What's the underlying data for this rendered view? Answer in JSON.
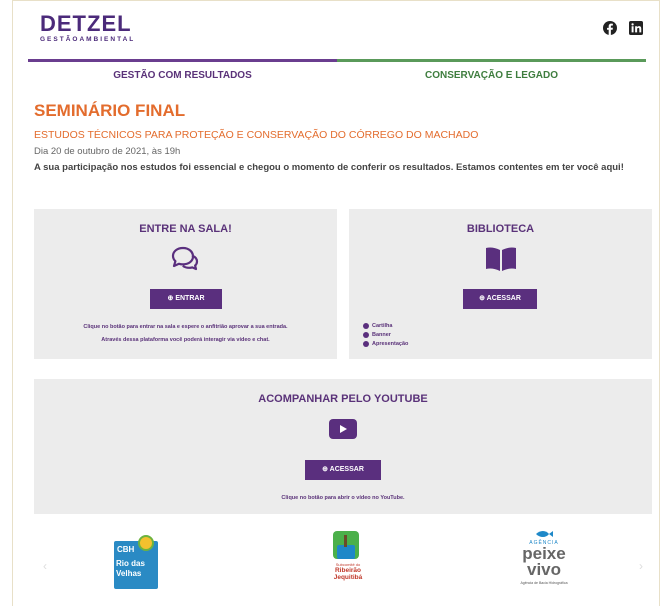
{
  "header": {
    "logo_main": "DETZEL",
    "logo_sub": "GESTÃOAMBIENTAL",
    "social": [
      {
        "name": "facebook-icon"
      },
      {
        "name": "linkedin-icon"
      }
    ]
  },
  "nav": {
    "left_label": "GESTÃO COM RESULTADOS",
    "right_label": "CONSERVAÇÃO E LEGADO",
    "left_color": "#6a3d8f",
    "right_color": "#5a9a5a"
  },
  "event": {
    "title": "SEMINÁRIO FINAL",
    "subtitle": "ESTUDOS TÉCNICOS PARA PROTEÇÃO E CONSERVAÇÃO DO CÓRREGO DO MACHADO",
    "date": "Dia 20 de outubro de 2021, às 19h",
    "intro": "A sua participação nos estudos foi essencial e chegou o momento de conferir os resultados. Estamos contentes em ter você aqui!"
  },
  "room": {
    "title": "ENTRE NA SALA!",
    "button": "ENTRAR",
    "text1": "Clique no botão para entrar na sala e espere o anfitrião aprovar a sua entrada.",
    "text2": "Através dessa plataforma você poderá interagir via vídeo e chat."
  },
  "library": {
    "title": "BIBLIOTECA",
    "button": "ACESSAR",
    "items": [
      "Cartilha",
      "Banner",
      "Apresentação"
    ]
  },
  "youtube": {
    "title": "ACOMPANHAR PELO YOUTUBE",
    "button": "ACESSAR",
    "text": "Clique no botão para abrir o vídeo no YouTube."
  },
  "sponsors": {
    "cbh_top": "CBH",
    "cbh_line1": "Rio das",
    "cbh_line2": "Velhas",
    "sub_line1": "Subcomitê do",
    "sub_line2": "Ribeirão",
    "sub_line3": "Jequitibá",
    "agency_top": "AGÊNCIA",
    "agency_line1": "peixe",
    "agency_line2": "vivo",
    "agency_bottom": "Agência de Bacia Hidrográfica"
  },
  "colors": {
    "purple": "#5a2f7e",
    "orange": "#e36c2d",
    "card_bg": "#ececec"
  }
}
